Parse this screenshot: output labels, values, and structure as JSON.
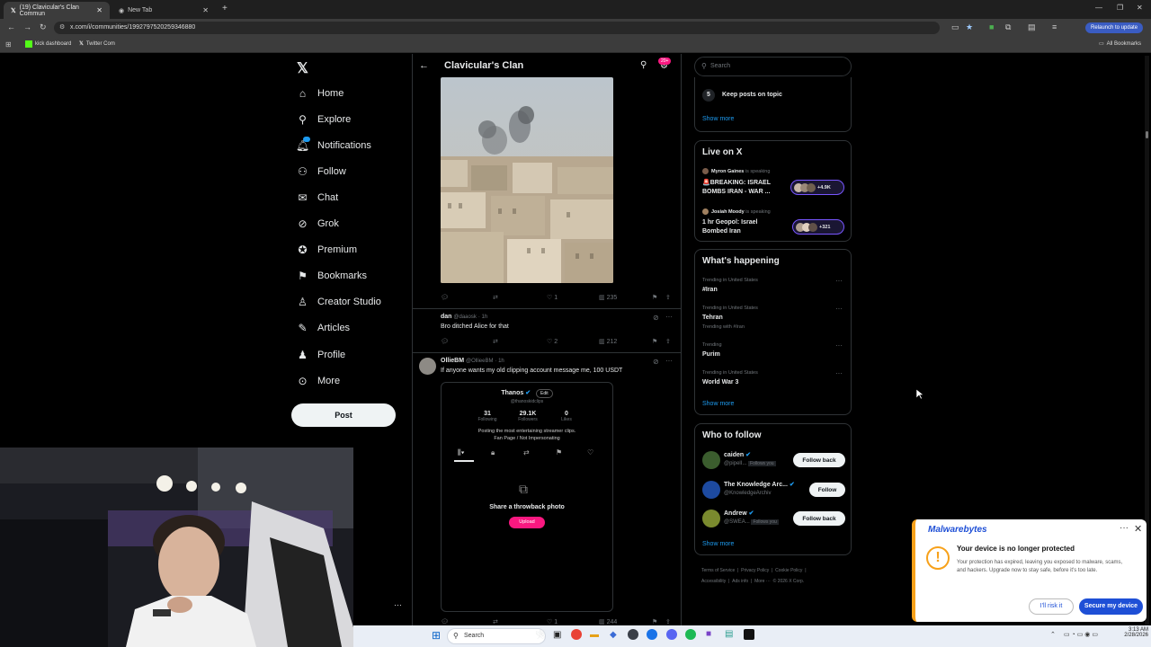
{
  "browser": {
    "tabs": [
      {
        "title": "(19) Clavicular's Clan Commun"
      },
      {
        "title": "New Tab"
      }
    ],
    "url": "x.com/i/communities/1992797520259346880",
    "bookmarks": [
      "kick dashboard",
      "Twitter Com"
    ],
    "all_bookmarks": "All Bookmarks",
    "relaunch": "Relaunch to update"
  },
  "sidebar": {
    "items": [
      {
        "label": "Home",
        "icon": "home-icon"
      },
      {
        "label": "Explore",
        "icon": "search-icon"
      },
      {
        "label": "Notifications",
        "icon": "bell-icon"
      },
      {
        "label": "Follow",
        "icon": "add-person-icon"
      },
      {
        "label": "Chat",
        "icon": "mail-icon"
      },
      {
        "label": "Grok",
        "icon": "grok-icon"
      },
      {
        "label": "Premium",
        "icon": "premium-icon"
      },
      {
        "label": "Bookmarks",
        "icon": "bookmark-icon"
      },
      {
        "label": "Creator Studio",
        "icon": "creator-icon"
      },
      {
        "label": "Articles",
        "icon": "articles-icon"
      },
      {
        "label": "Profile",
        "icon": "person-icon"
      },
      {
        "label": "More",
        "icon": "more-circle-icon"
      }
    ],
    "post_label": "Post",
    "notif_badge": ""
  },
  "header": {
    "title": "Clavicular's Clan",
    "badge": "20+"
  },
  "posts": [
    {
      "actions": {
        "likes": "1",
        "views": "235"
      }
    },
    {
      "user": "dan",
      "handle": "@daaosk",
      "time": "· 1h",
      "text": "Bro ditched Alice for that",
      "actions": {
        "likes": "2",
        "views": "212"
      }
    },
    {
      "user": "OllieBM",
      "handle": "@OllieeBM",
      "time": "· 1h",
      "text": "If anyone wants my old clipping account message me, 100 USDT",
      "embed": {
        "name": "Thanos",
        "edit": "Edit",
        "handle": "@thanoskidclips",
        "stats": [
          {
            "value": "31",
            "label": "Following"
          },
          {
            "value": "29.1K",
            "label": "Followers"
          },
          {
            "value": "0",
            "label": "Likes"
          }
        ],
        "bio1": "Posting the most entertaining streamer clips.",
        "bio2": "Fan Page / Not Impersonating",
        "throwback": "Share a throwback photo",
        "upload": "Upload"
      },
      "actions": {
        "likes": "1",
        "views": "244"
      }
    }
  ],
  "right": {
    "search_placeholder": "Search",
    "rules": {
      "number": "5",
      "text": "Keep posts on topic",
      "show_more": "Show more"
    },
    "live": {
      "title": "Live on X",
      "items": [
        {
          "host": "Myron Gaines",
          "speaking": "is speaking",
          "title1": "🚨BREAKING: ISRAEL",
          "title2": "BOMBS IRAN - WAR ...",
          "count": "+4.9K"
        },
        {
          "host": "Josiah Moody",
          "speaking": "is speaking",
          "title1": "1 hr Geopol: Israel",
          "title2": "Bombed Iran",
          "count": "+321"
        }
      ]
    },
    "happening": {
      "title": "What's happening",
      "trends": [
        {
          "meta": "Trending in United States",
          "name": "#Iran",
          "extra": ""
        },
        {
          "meta": "Trending in United States",
          "name": "Tehran",
          "extra": "Trending with #Iran"
        },
        {
          "meta": "Trending",
          "name": "Purim",
          "extra": ""
        },
        {
          "meta": "Trending in United States",
          "name": "World War 3",
          "extra": ""
        }
      ],
      "show_more": "Show more"
    },
    "who": {
      "title": "Who to follow",
      "users": [
        {
          "name": "caiden",
          "handle": "@pipelI...",
          "follows_you": "Follows you",
          "button": "Follow back"
        },
        {
          "name": "The Knowledge Arc...",
          "handle": "@KnowledgeArchiv",
          "follows_you": "",
          "button": "Follow"
        },
        {
          "name": "Andrew",
          "handle": "@SWEA...",
          "follows_you": "Follows you",
          "button": "Follow back"
        }
      ],
      "show_more": "Show more"
    },
    "footer": [
      "Terms of Service",
      "|",
      "Privacy Policy",
      "|",
      "Cookie Policy",
      "|",
      "Accessibility",
      "|",
      "Ads info",
      "|",
      "More ···",
      "© 2026 X Corp."
    ]
  },
  "malwarebytes": {
    "brand": "Malwarebytes",
    "title": "Your device is no longer protected",
    "body": "Your protection has expired, leaving you exposed to malware, scams, and hackers. Upgrade now to stay safe, before it's too late.",
    "btn_secondary": "I'll risk it",
    "btn_primary": "Secure my device"
  },
  "taskbar": {
    "search": "Search",
    "time": "3:13 AM",
    "date": "2/28/2026"
  },
  "colors": {
    "accent": "#1d9bf0",
    "premium_pink": "#f91880",
    "mb_blue": "#1e4fd6"
  }
}
